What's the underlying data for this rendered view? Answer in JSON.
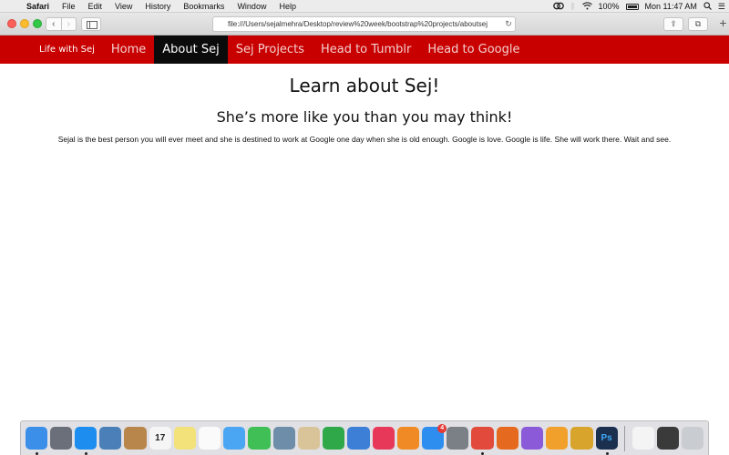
{
  "menubar": {
    "items": [
      "Safari",
      "File",
      "Edit",
      "View",
      "History",
      "Bookmarks",
      "Window",
      "Help"
    ],
    "battery": "100%",
    "clock": "Mon 11:47 AM"
  },
  "toolbar": {
    "url": "file:///Users/sejalmehra/Desktop/review%20week/bootstrap%20projects/aboutsej"
  },
  "site_nav": {
    "brand": "Life with Sej",
    "links": [
      {
        "label": "Home",
        "active": false
      },
      {
        "label": "About Sej",
        "active": true
      },
      {
        "label": "Sej Projects",
        "active": false
      },
      {
        "label": "Head to Tumblr",
        "active": false
      },
      {
        "label": "Head to Google",
        "active": false
      }
    ]
  },
  "content": {
    "heading": "Learn about Sej!",
    "subheading": "She’s more like you than you may think!",
    "paragraph": "Sejal is the best person you will ever meet and she is destined to work at Google one day when she is old enough. Google is love. Google is life. She will work there. Wait and see."
  },
  "dock": {
    "calendar_day": "17",
    "appstore_badge": "4",
    "icons": [
      {
        "name": "finder-icon",
        "color": "#3b8fe8",
        "running": true
      },
      {
        "name": "launchpad-icon",
        "color": "#6a6f7a",
        "running": false
      },
      {
        "name": "safari-icon",
        "color": "#1d8ef0",
        "running": true
      },
      {
        "name": "preview-icon",
        "color": "#4a7fb8",
        "running": false
      },
      {
        "name": "contacts-icon",
        "color": "#b8864a",
        "running": false
      },
      {
        "name": "calendar-icon",
        "color": "#f5f5f5",
        "running": false
      },
      {
        "name": "notes-icon",
        "color": "#f3e27a",
        "running": false
      },
      {
        "name": "reminders-icon",
        "color": "#fafafa",
        "running": false
      },
      {
        "name": "messages-icon",
        "color": "#4aa6f2",
        "running": false
      },
      {
        "name": "facetime-icon",
        "color": "#3fbf55",
        "running": false
      },
      {
        "name": "photos-icon",
        "color": "#6d8da8",
        "running": false
      },
      {
        "name": "notes-editor-icon",
        "color": "#d9c49a",
        "running": false
      },
      {
        "name": "numbers-icon",
        "color": "#2fa84a",
        "running": false
      },
      {
        "name": "keynote-icon",
        "color": "#3d7fd6",
        "running": false
      },
      {
        "name": "itunes-icon",
        "color": "#e8385a",
        "running": false
      },
      {
        "name": "ibooks-icon",
        "color": "#f08a24",
        "running": false
      },
      {
        "name": "app-store-icon",
        "color": "#2e8ef0",
        "running": false
      },
      {
        "name": "system-preferences-icon",
        "color": "#7b7f86",
        "running": false
      },
      {
        "name": "chrome-icon",
        "color": "#e24a3b",
        "running": true
      },
      {
        "name": "firefox-icon",
        "color": "#e56a1f",
        "running": false
      },
      {
        "name": "flower-app-icon",
        "color": "#8a5ad8",
        "running": false
      },
      {
        "name": "scratch-icon",
        "color": "#f2a02c",
        "running": false
      },
      {
        "name": "wolfram-icon",
        "color": "#d9a42b",
        "running": false
      },
      {
        "name": "photoshop-icon",
        "color": "#1b2f4f",
        "running": true
      }
    ],
    "trailing": [
      {
        "name": "document-icon",
        "color": "#f4f4f4"
      },
      {
        "name": "terminal-folder-icon",
        "color": "#3a3a3a"
      },
      {
        "name": "trash-icon",
        "color": "#c9cdd2"
      }
    ]
  }
}
